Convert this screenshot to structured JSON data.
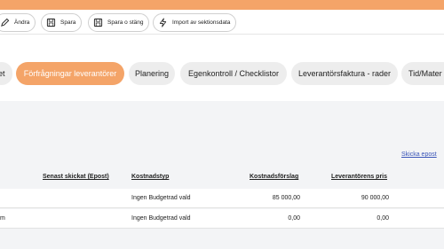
{
  "colors": {
    "accent": "#f4a468",
    "link": "#3b56b8",
    "background": "#f3f4f6"
  },
  "toolbar": {
    "edit_label": "Ändra",
    "save_label": "Spara",
    "save_close_label": "Spara o stäng",
    "import_label": "Import av sektionsdata"
  },
  "tabs": [
    {
      "label": "et"
    },
    {
      "label": "Förfrågningar leverantörer",
      "active": true
    },
    {
      "label": "Planering"
    },
    {
      "label": "Egenkontroll / Checklistor"
    },
    {
      "label": "Leverantörsfaktura - rader"
    },
    {
      "label": "Tid/Mater"
    }
  ],
  "actions": {
    "send_email_link": "Skicka epost"
  },
  "table": {
    "columns": [
      "Senast skickat (Epost)",
      "Kostnadstyp",
      "Kostnadsförslag",
      "Leverantörens pris"
    ],
    "rows": [
      {
        "first": "",
        "sent": "",
        "cost_type": "Ingen Budgetrad vald",
        "proposal": "85 000,00",
        "price": "90 000,00"
      },
      {
        "first": "m",
        "sent": "",
        "cost_type": "Ingen Budgetrad vald",
        "proposal": "0,00",
        "price": "0,00"
      }
    ]
  }
}
